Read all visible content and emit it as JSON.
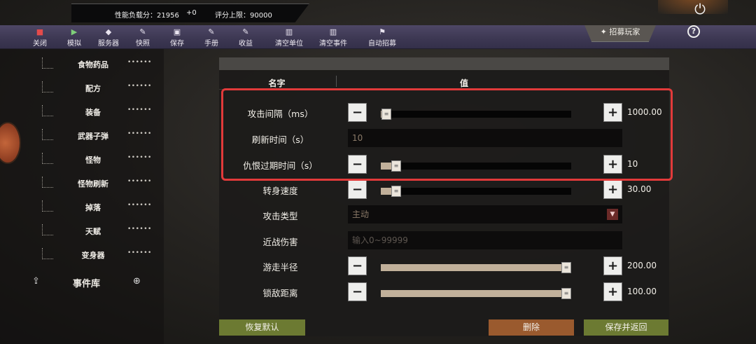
{
  "status": {
    "load_label": "性能负载分：21956",
    "load_delta": "+0",
    "limit_label": "评分上限：90000"
  },
  "toolbar": {
    "items": [
      {
        "label": "关闭",
        "icon": "stop-icon"
      },
      {
        "label": "模拟",
        "icon": "play-icon"
      },
      {
        "label": "服务器",
        "icon": "cube-icon"
      },
      {
        "label": "快照",
        "icon": "edit-icon"
      },
      {
        "label": "保存",
        "icon": "save-icon"
      },
      {
        "label": "手册",
        "icon": "edit-icon"
      },
      {
        "label": "收益",
        "icon": "edit-icon"
      },
      {
        "label": "清空单位",
        "icon": "trash-icon"
      },
      {
        "label": "清空事件",
        "icon": "trash-icon"
      },
      {
        "label": "自动招募",
        "icon": "flag-icon"
      }
    ],
    "recruit_label": "招募玩家",
    "help_label": "?"
  },
  "sidebar": {
    "items": [
      {
        "label": "食物药品",
        "dots": "••••••"
      },
      {
        "label": "配方",
        "dots": "••••••"
      },
      {
        "label": "装备",
        "dots": "••••••"
      },
      {
        "label": "武器子弹",
        "dots": "••••••"
      },
      {
        "label": "怪物",
        "dots": "••••••"
      },
      {
        "label": "怪物刷新",
        "dots": "••••••"
      },
      {
        "label": "掉落",
        "dots": "••••••"
      },
      {
        "label": "天赋",
        "dots": "••••••"
      },
      {
        "label": "变身器",
        "dots": "••••••"
      }
    ],
    "event_library_label": "事件库"
  },
  "dialog": {
    "col_name": "名字",
    "col_value": "值",
    "rows": [
      {
        "name": "攻击间隔（ms）",
        "kind": "slider",
        "value": "1000.00",
        "fill": 0.03
      },
      {
        "name": "刷新时间（s）",
        "kind": "text",
        "value": "10"
      },
      {
        "name": "仇恨过期时间（s）",
        "kind": "slider",
        "value": "10",
        "fill": 0.08
      },
      {
        "name": "转身速度",
        "kind": "slider",
        "value": "30.00",
        "fill": 0.08
      },
      {
        "name": "攻击类型",
        "kind": "dropdown",
        "value": "主动"
      },
      {
        "name": "近战伤害",
        "kind": "input",
        "placeholder": "输入0~99999"
      },
      {
        "name": "游走半径",
        "kind": "slider",
        "value": "200.00",
        "fill": 1.0
      },
      {
        "name": "锁敌距离",
        "kind": "slider",
        "value": "100.00",
        "fill": 1.0
      }
    ],
    "buttons": {
      "reset": "恢复默认",
      "delete": "删除",
      "save_return": "保存并返回"
    }
  },
  "colors": {
    "highlight": "#e23a3a",
    "toolbar": "#3c3752",
    "button_green": "#6c7a32",
    "button_orange": "#9a5a2e"
  }
}
